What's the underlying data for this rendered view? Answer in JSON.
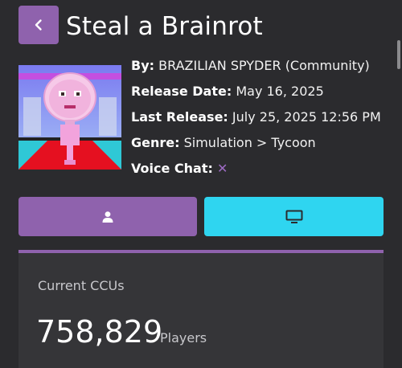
{
  "header": {
    "title": "Steal a Brainrot"
  },
  "details": {
    "by_label": "By:",
    "by_value": "BRAZILIAN SPYDER (Community)",
    "release_label": "Release Date:",
    "release_value": "May 16, 2025",
    "last_release_label": "Last Release:",
    "last_release_value": "July 25, 2025 12:56 PM",
    "genre_label": "Genre:",
    "genre_value": "Simulation > Tycoon",
    "voice_label": "Voice Chat:",
    "voice_value": "✕"
  },
  "actions": {
    "user_icon": "user-icon",
    "screen_icon": "monitor-icon"
  },
  "stats": {
    "label": "Current CCUs",
    "value": "758,829",
    "unit": "Players"
  },
  "colors": {
    "background": "#2b2b2e",
    "accent_purple": "#8f62ad",
    "accent_cyan": "#2fd5f0",
    "card": "#353538"
  }
}
